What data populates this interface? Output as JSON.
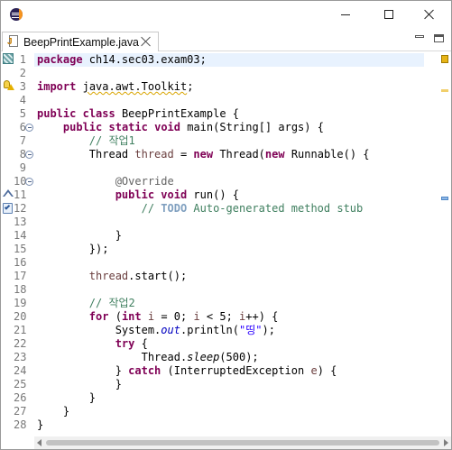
{
  "window": {
    "app_icon": "eclipse-icon",
    "controls": {
      "minimize": "minimize-icon",
      "maximize": "maximize-icon",
      "close": "close-icon"
    }
  },
  "editor_tab": {
    "title": "BeepPrintExample.java",
    "icon": "java-file-icon",
    "close_icon": "close-icon"
  },
  "view_controls": {
    "minimize": "minimize-view-icon",
    "maximize": "maximize-view-icon"
  },
  "editor": {
    "current_line": 1,
    "lines": [
      {
        "n": "1",
        "html": "<span class=\"kw\">package</span> ch14.sec03.exam03;"
      },
      {
        "n": "2",
        "html": ""
      },
      {
        "n": "3",
        "html": "<span class=\"kw\">import</span> <span class=\"warn-underline\">java.awt.Toolkit</span>;"
      },
      {
        "n": "4",
        "html": ""
      },
      {
        "n": "5",
        "html": "<span class=\"kw\">public</span> <span class=\"kw\">class</span> BeepPrintExample {"
      },
      {
        "n": "6",
        "html": "    <span class=\"kw\">public</span> <span class=\"kw\">static</span> <span class=\"kw\">void</span> main(String[] args) {",
        "fold": true
      },
      {
        "n": "7",
        "html": "        <span class=\"cm\">// 작업1</span>"
      },
      {
        "n": "8",
        "html": "        Thread <span class=\"var\">thread</span> = <span class=\"kw\">new</span> Thread(<span class=\"kw\">new</span> Runnable() {",
        "fold": true
      },
      {
        "n": "9",
        "html": ""
      },
      {
        "n": "10",
        "html": "            <span class=\"ann\">@Override</span>",
        "fold": true
      },
      {
        "n": "11",
        "html": "            <span class=\"kw\">public</span> <span class=\"kw\">void</span> run() {"
      },
      {
        "n": "12",
        "html": "                <span class=\"cm\">// </span><span class=\"todo\">TODO</span><span class=\"cm\"> Auto-generated method stub</span>"
      },
      {
        "n": "13",
        "html": ""
      },
      {
        "n": "14",
        "html": "            }"
      },
      {
        "n": "15",
        "html": "        });"
      },
      {
        "n": "16",
        "html": ""
      },
      {
        "n": "17",
        "html": "        <span class=\"var\">thread</span>.start();"
      },
      {
        "n": "18",
        "html": ""
      },
      {
        "n": "19",
        "html": "        <span class=\"cm\">// 작업2</span>"
      },
      {
        "n": "20",
        "html": "        <span class=\"kw\">for</span> (<span class=\"kw\">int</span> <span class=\"var\">i</span> = 0; <span class=\"var\">i</span> &lt; 5; <span class=\"var\">i</span>++) {"
      },
      {
        "n": "21",
        "html": "            System.<span class=\"fld\">out</span>.println(<span class=\"str\">\"띵\"</span>);"
      },
      {
        "n": "22",
        "html": "            <span class=\"kw\">try</span> {"
      },
      {
        "n": "23",
        "html": "                Thread.<span class=\"it\">sleep</span>(500);"
      },
      {
        "n": "24",
        "html": "            } <span class=\"kw\">catch</span> (InterruptedException <span class=\"var\">e</span>) {"
      },
      {
        "n": "25",
        "html": "            }"
      },
      {
        "n": "26",
        "html": "        }"
      },
      {
        "n": "27",
        "html": "    }"
      },
      {
        "n": "28",
        "html": "}"
      }
    ]
  },
  "gutter_markers": {
    "line1": "bookmark-icon",
    "line3": "warning-bulb-icon",
    "line11": "override-triangle-icon",
    "line12": "task-icon"
  },
  "overview_ruler": [
    "warning-summary-icon",
    "warning-marker",
    "task-marker"
  ],
  "colors": {
    "keyword": "#7f0055",
    "comment": "#3f7f5f",
    "string": "#2a00ff",
    "field": "#0000c0",
    "annotation": "#646464",
    "current_line": "#e8f2fe"
  }
}
